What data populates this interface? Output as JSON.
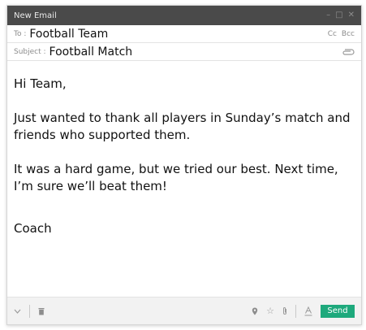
{
  "window": {
    "title": "New Email",
    "minimize": "–",
    "maximize": "□",
    "close": "✕"
  },
  "to": {
    "label": "To :",
    "value": "Football Team"
  },
  "cc_label": "Cc",
  "bcc_label": "Bcc",
  "subject": {
    "label": "Subject :",
    "value": "Football Match"
  },
  "body": {
    "greeting": "Hi Team,",
    "paragraph1": "Just wanted to thank all players in Sunday’s match and friends who supported them.",
    "paragraph2": "It was a hard game, but we tried our best. Next time, I’m sure we’ll beat them!",
    "signature": "Coach"
  },
  "footer": {
    "send_label": "Send",
    "icons": [
      "chevron-down-icon",
      "trash-icon",
      "location-pin-icon",
      "star-icon",
      "attachment-icon",
      "text-format-icon"
    ]
  },
  "colors": {
    "titlebar": "#4a4a4a",
    "send": "#1ea97c",
    "footer": "#f2f2f2"
  }
}
